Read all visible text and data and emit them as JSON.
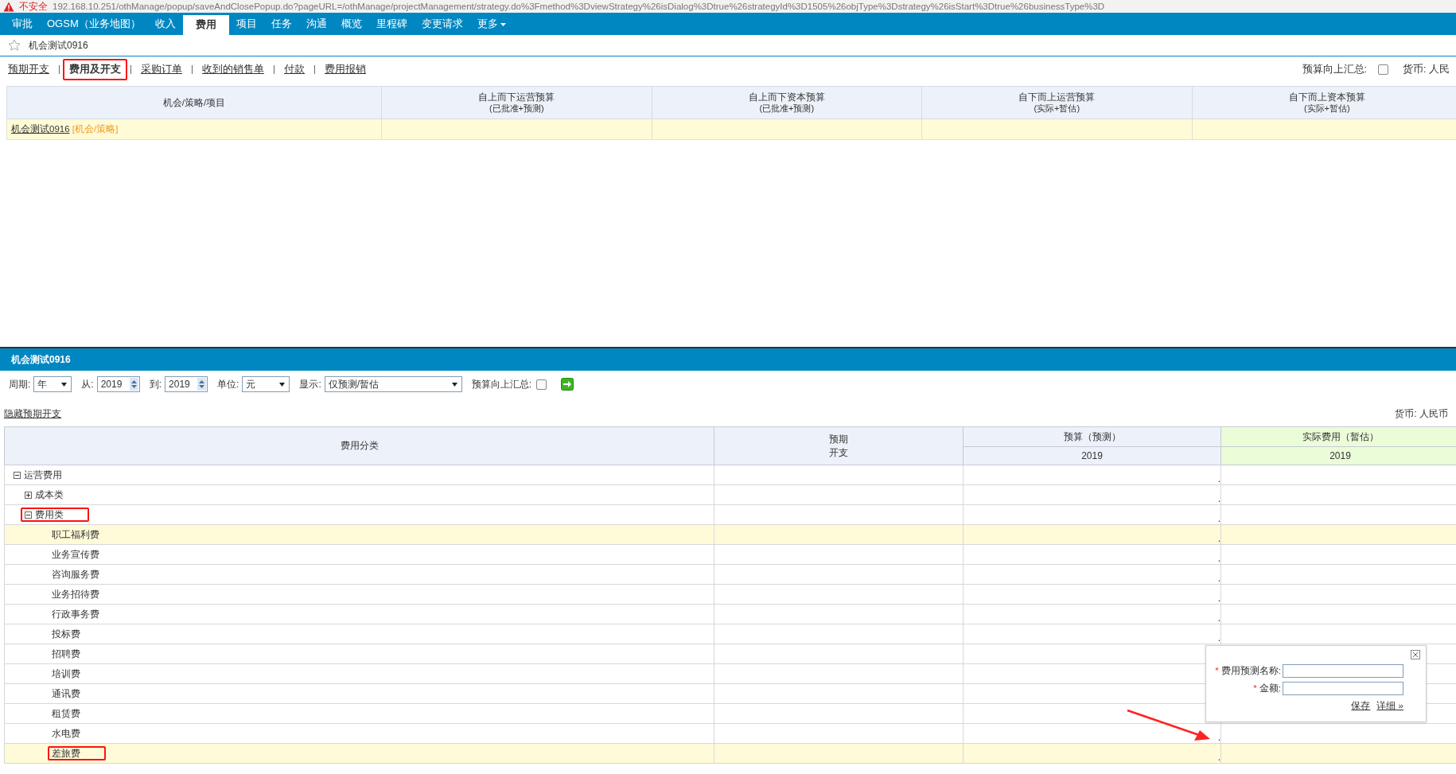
{
  "address_bar": {
    "security": "不安全",
    "url": "192.168.10.251/othManage/popup/saveAndClosePopup.do?pageURL=/othManage/projectManagement/strategy.do%3Fmethod%3DviewStrategy%26isDialog%3Dtrue%26strategyId%3D1505%26objType%3Dstrategy%26isStart%3Dtrue%26businessType%3D"
  },
  "nav": [
    {
      "label": "审批",
      "selected": false,
      "dropdown": false
    },
    {
      "label": "OGSM（业务地图）",
      "selected": false,
      "dropdown": false
    },
    {
      "label": "收入",
      "selected": false,
      "dropdown": false
    },
    {
      "label": "费用",
      "selected": true,
      "dropdown": false
    },
    {
      "label": "项目",
      "selected": false,
      "dropdown": false
    },
    {
      "label": "任务",
      "selected": false,
      "dropdown": false
    },
    {
      "label": "沟通",
      "selected": false,
      "dropdown": false
    },
    {
      "label": "概览",
      "selected": false,
      "dropdown": false
    },
    {
      "label": "里程碑",
      "selected": false,
      "dropdown": false
    },
    {
      "label": "变更请求",
      "selected": false,
      "dropdown": false
    },
    {
      "label": "更多",
      "selected": false,
      "dropdown": true
    }
  ],
  "breadcrumb": {
    "title": "机会测试0916",
    "favorite": false
  },
  "subtabs": [
    {
      "label": "预期开支",
      "selected": false,
      "marked": false
    },
    {
      "label": "费用及开支",
      "selected": true,
      "marked": true
    },
    {
      "label": "采购订单",
      "selected": false,
      "marked": false
    },
    {
      "label": "收到的销售单",
      "selected": false,
      "marked": false
    },
    {
      "label": "付款",
      "selected": false,
      "marked": false
    },
    {
      "label": "费用报销",
      "selected": false,
      "marked": false
    }
  ],
  "summary_options": {
    "rollup_label": "预算向上汇总:",
    "rollup_checked": false,
    "currency": "货币: 人民"
  },
  "strategy_table": {
    "columns": [
      {
        "line1": "机会/策略/项目"
      },
      {
        "line1": "自上而下运营预算",
        "line2": "(已批准+预测)"
      },
      {
        "line1": "自上而下资本预算",
        "line2": "(已批准+预测)"
      },
      {
        "line1": "自下而上运营预算",
        "line2": "(实际+暂估)"
      },
      {
        "line1": "自下而上资本预算",
        "line2": "(实际+暂估)"
      }
    ],
    "rows": [
      {
        "name": "机会测试0916",
        "tag": "[机会/策略]"
      }
    ]
  },
  "panel": {
    "title": "机会测试0916",
    "toolbar": {
      "period_label": "周期:",
      "period": "年",
      "from_label": "从:",
      "from": "2019",
      "to_label": "到:",
      "to": "2019",
      "unit_label": "单位:",
      "unit": "元",
      "show_label": "显示:",
      "show": "仅预测/暂估",
      "rollup_label": "预算向上汇总:",
      "rollup_checked": false
    },
    "hide_link": "隐藏预期开支",
    "currency": "货币: 人民币"
  },
  "expense_table": {
    "columns": {
      "category": "费用分类",
      "expected": [
        "预期",
        "开支"
      ],
      "budget": "预算（预测）",
      "actual": "实际费用（暂估）",
      "budget_year": "2019",
      "actual_year": "2019"
    },
    "rows": [
      {
        "name": "运营费用",
        "expanded": true,
        "highlighted": false,
        "marked": false,
        "budget": ".",
        "children": [
          {
            "name": "成本类",
            "expanded": false,
            "highlighted": false,
            "marked": false,
            "budget": "."
          },
          {
            "name": "费用类",
            "expanded": true,
            "highlighted": false,
            "marked": true,
            "budget": ".",
            "children": [
              {
                "name": "职工福利费",
                "highlighted": true,
                "marked": false,
                "budget": "."
              },
              {
                "name": "业务宣传费",
                "highlighted": false,
                "marked": false,
                "budget": "."
              },
              {
                "name": "咨询服务费",
                "highlighted": false,
                "marked": false,
                "budget": "."
              },
              {
                "name": "业务招待费",
                "highlighted": false,
                "marked": false,
                "budget": "."
              },
              {
                "name": "行政事务费",
                "highlighted": false,
                "marked": false,
                "budget": "."
              },
              {
                "name": "投标费",
                "highlighted": false,
                "marked": false,
                "budget": "."
              },
              {
                "name": "招聘费",
                "highlighted": false,
                "marked": false
              },
              {
                "name": "培训费",
                "highlighted": false,
                "marked": false
              },
              {
                "name": "通讯费",
                "highlighted": false,
                "marked": false
              },
              {
                "name": "租赁费",
                "highlighted": false,
                "marked": false
              },
              {
                "name": "水电费",
                "highlighted": false,
                "marked": false,
                "budget": "."
              },
              {
                "name": "差旅费",
                "highlighted": true,
                "marked": true,
                "budget": "."
              }
            ]
          }
        ]
      }
    ]
  },
  "forecast_popup": {
    "name_label": "费用预测名称:",
    "amount_label": "金额:",
    "required_mark": "*",
    "save": "保存",
    "details": "详细 »"
  }
}
